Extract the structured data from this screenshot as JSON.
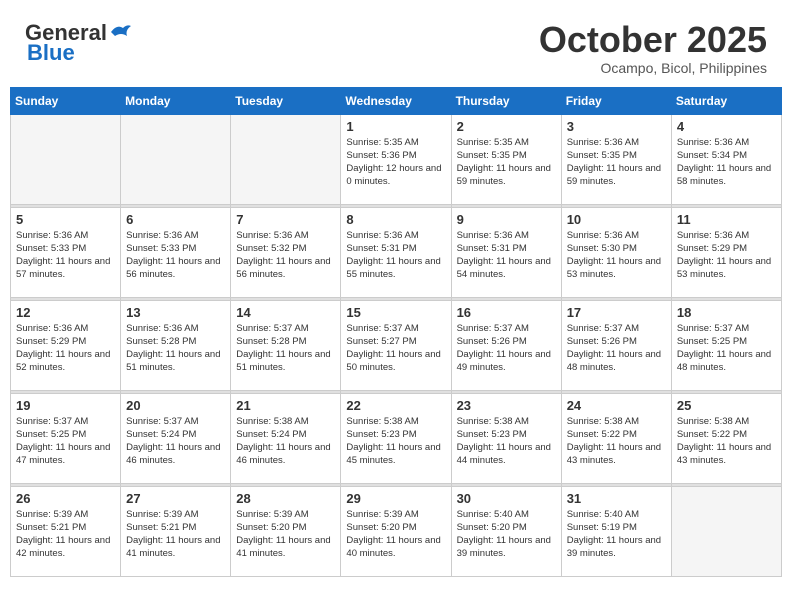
{
  "header": {
    "logo_general": "General",
    "logo_blue": "Blue",
    "month": "October 2025",
    "location": "Ocampo, Bicol, Philippines"
  },
  "weekdays": [
    "Sunday",
    "Monday",
    "Tuesday",
    "Wednesday",
    "Thursday",
    "Friday",
    "Saturday"
  ],
  "weeks": [
    [
      {
        "day": "",
        "sunrise": "",
        "sunset": "",
        "daylight": "",
        "empty": true
      },
      {
        "day": "",
        "sunrise": "",
        "sunset": "",
        "daylight": "",
        "empty": true
      },
      {
        "day": "",
        "sunrise": "",
        "sunset": "",
        "daylight": "",
        "empty": true
      },
      {
        "day": "1",
        "sunrise": "Sunrise: 5:35 AM",
        "sunset": "Sunset: 5:36 PM",
        "daylight": "Daylight: 12 hours and 0 minutes."
      },
      {
        "day": "2",
        "sunrise": "Sunrise: 5:35 AM",
        "sunset": "Sunset: 5:35 PM",
        "daylight": "Daylight: 11 hours and 59 minutes."
      },
      {
        "day": "3",
        "sunrise": "Sunrise: 5:36 AM",
        "sunset": "Sunset: 5:35 PM",
        "daylight": "Daylight: 11 hours and 59 minutes."
      },
      {
        "day": "4",
        "sunrise": "Sunrise: 5:36 AM",
        "sunset": "Sunset: 5:34 PM",
        "daylight": "Daylight: 11 hours and 58 minutes."
      }
    ],
    [
      {
        "day": "5",
        "sunrise": "Sunrise: 5:36 AM",
        "sunset": "Sunset: 5:33 PM",
        "daylight": "Daylight: 11 hours and 57 minutes."
      },
      {
        "day": "6",
        "sunrise": "Sunrise: 5:36 AM",
        "sunset": "Sunset: 5:33 PM",
        "daylight": "Daylight: 11 hours and 56 minutes."
      },
      {
        "day": "7",
        "sunrise": "Sunrise: 5:36 AM",
        "sunset": "Sunset: 5:32 PM",
        "daylight": "Daylight: 11 hours and 56 minutes."
      },
      {
        "day": "8",
        "sunrise": "Sunrise: 5:36 AM",
        "sunset": "Sunset: 5:31 PM",
        "daylight": "Daylight: 11 hours and 55 minutes."
      },
      {
        "day": "9",
        "sunrise": "Sunrise: 5:36 AM",
        "sunset": "Sunset: 5:31 PM",
        "daylight": "Daylight: 11 hours and 54 minutes."
      },
      {
        "day": "10",
        "sunrise": "Sunrise: 5:36 AM",
        "sunset": "Sunset: 5:30 PM",
        "daylight": "Daylight: 11 hours and 53 minutes."
      },
      {
        "day": "11",
        "sunrise": "Sunrise: 5:36 AM",
        "sunset": "Sunset: 5:29 PM",
        "daylight": "Daylight: 11 hours and 53 minutes."
      }
    ],
    [
      {
        "day": "12",
        "sunrise": "Sunrise: 5:36 AM",
        "sunset": "Sunset: 5:29 PM",
        "daylight": "Daylight: 11 hours and 52 minutes."
      },
      {
        "day": "13",
        "sunrise": "Sunrise: 5:36 AM",
        "sunset": "Sunset: 5:28 PM",
        "daylight": "Daylight: 11 hours and 51 minutes."
      },
      {
        "day": "14",
        "sunrise": "Sunrise: 5:37 AM",
        "sunset": "Sunset: 5:28 PM",
        "daylight": "Daylight: 11 hours and 51 minutes."
      },
      {
        "day": "15",
        "sunrise": "Sunrise: 5:37 AM",
        "sunset": "Sunset: 5:27 PM",
        "daylight": "Daylight: 11 hours and 50 minutes."
      },
      {
        "day": "16",
        "sunrise": "Sunrise: 5:37 AM",
        "sunset": "Sunset: 5:26 PM",
        "daylight": "Daylight: 11 hours and 49 minutes."
      },
      {
        "day": "17",
        "sunrise": "Sunrise: 5:37 AM",
        "sunset": "Sunset: 5:26 PM",
        "daylight": "Daylight: 11 hours and 48 minutes."
      },
      {
        "day": "18",
        "sunrise": "Sunrise: 5:37 AM",
        "sunset": "Sunset: 5:25 PM",
        "daylight": "Daylight: 11 hours and 48 minutes."
      }
    ],
    [
      {
        "day": "19",
        "sunrise": "Sunrise: 5:37 AM",
        "sunset": "Sunset: 5:25 PM",
        "daylight": "Daylight: 11 hours and 47 minutes."
      },
      {
        "day": "20",
        "sunrise": "Sunrise: 5:37 AM",
        "sunset": "Sunset: 5:24 PM",
        "daylight": "Daylight: 11 hours and 46 minutes."
      },
      {
        "day": "21",
        "sunrise": "Sunrise: 5:38 AM",
        "sunset": "Sunset: 5:24 PM",
        "daylight": "Daylight: 11 hours and 46 minutes."
      },
      {
        "day": "22",
        "sunrise": "Sunrise: 5:38 AM",
        "sunset": "Sunset: 5:23 PM",
        "daylight": "Daylight: 11 hours and 45 minutes."
      },
      {
        "day": "23",
        "sunrise": "Sunrise: 5:38 AM",
        "sunset": "Sunset: 5:23 PM",
        "daylight": "Daylight: 11 hours and 44 minutes."
      },
      {
        "day": "24",
        "sunrise": "Sunrise: 5:38 AM",
        "sunset": "Sunset: 5:22 PM",
        "daylight": "Daylight: 11 hours and 43 minutes."
      },
      {
        "day": "25",
        "sunrise": "Sunrise: 5:38 AM",
        "sunset": "Sunset: 5:22 PM",
        "daylight": "Daylight: 11 hours and 43 minutes."
      }
    ],
    [
      {
        "day": "26",
        "sunrise": "Sunrise: 5:39 AM",
        "sunset": "Sunset: 5:21 PM",
        "daylight": "Daylight: 11 hours and 42 minutes."
      },
      {
        "day": "27",
        "sunrise": "Sunrise: 5:39 AM",
        "sunset": "Sunset: 5:21 PM",
        "daylight": "Daylight: 11 hours and 41 minutes."
      },
      {
        "day": "28",
        "sunrise": "Sunrise: 5:39 AM",
        "sunset": "Sunset: 5:20 PM",
        "daylight": "Daylight: 11 hours and 41 minutes."
      },
      {
        "day": "29",
        "sunrise": "Sunrise: 5:39 AM",
        "sunset": "Sunset: 5:20 PM",
        "daylight": "Daylight: 11 hours and 40 minutes."
      },
      {
        "day": "30",
        "sunrise": "Sunrise: 5:40 AM",
        "sunset": "Sunset: 5:20 PM",
        "daylight": "Daylight: 11 hours and 39 minutes."
      },
      {
        "day": "31",
        "sunrise": "Sunrise: 5:40 AM",
        "sunset": "Sunset: 5:19 PM",
        "daylight": "Daylight: 11 hours and 39 minutes."
      },
      {
        "day": "",
        "sunrise": "",
        "sunset": "",
        "daylight": "",
        "empty": true
      }
    ]
  ]
}
